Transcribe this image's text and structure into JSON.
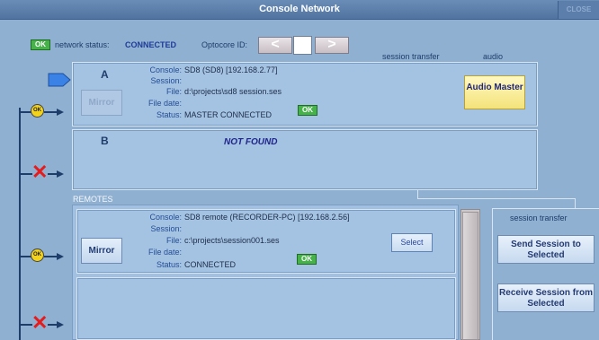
{
  "window": {
    "title": "Console Network",
    "close_label": "CLOSE"
  },
  "status": {
    "ok_badge": "OK",
    "label": "network status:",
    "value": "CONNECTED",
    "optocore_label": "Optocore ID:",
    "optocore_value": "",
    "prev_glyph": "<",
    "next_glyph": ">"
  },
  "headers": {
    "session_transfer": "session transfer",
    "audio": "audio"
  },
  "labels": {
    "console": "Console:",
    "session": "Session:",
    "file": "File:",
    "file_date": "File date:",
    "status": "Status:"
  },
  "slot_a": {
    "letter": "A",
    "mirror_label": "Mirror",
    "console": "SD8 (SD8)  [192.168.2.77]",
    "session": "",
    "file": "d:\\projects\\sd8 session.ses",
    "file_date": "",
    "status": "MASTER CONNECTED",
    "ok_badge": "OK",
    "audio_button": "Audio Master"
  },
  "slot_b": {
    "letter": "B",
    "message": "NOT FOUND"
  },
  "remotes": {
    "label": "REMOTES",
    "items": [
      {
        "mirror_label": "Mirror",
        "console": "SD8 remote (RECORDER-PC)  [192.168.2.56]",
        "session": "",
        "file": "c:\\projects\\session001.ses",
        "file_date": "",
        "status": "CONNECTED",
        "ok_badge": "OK",
        "select_label": "Select"
      }
    ]
  },
  "transfer": {
    "title": "session transfer",
    "send_label": "Send Session to Selected",
    "receive_label": "Receive Session from Selected"
  },
  "tree": {
    "node_ok_label": "OK",
    "nodes": [
      "ok",
      "x",
      "ok",
      "x"
    ]
  },
  "colors": {
    "background": "#8fb0d0",
    "panel": "#a4c2e2",
    "ok_green": "#47b14a",
    "audio_master_yellow": "#f4e37a",
    "error_red": "#e61b1b",
    "node_yellow": "#f2d21b"
  }
}
